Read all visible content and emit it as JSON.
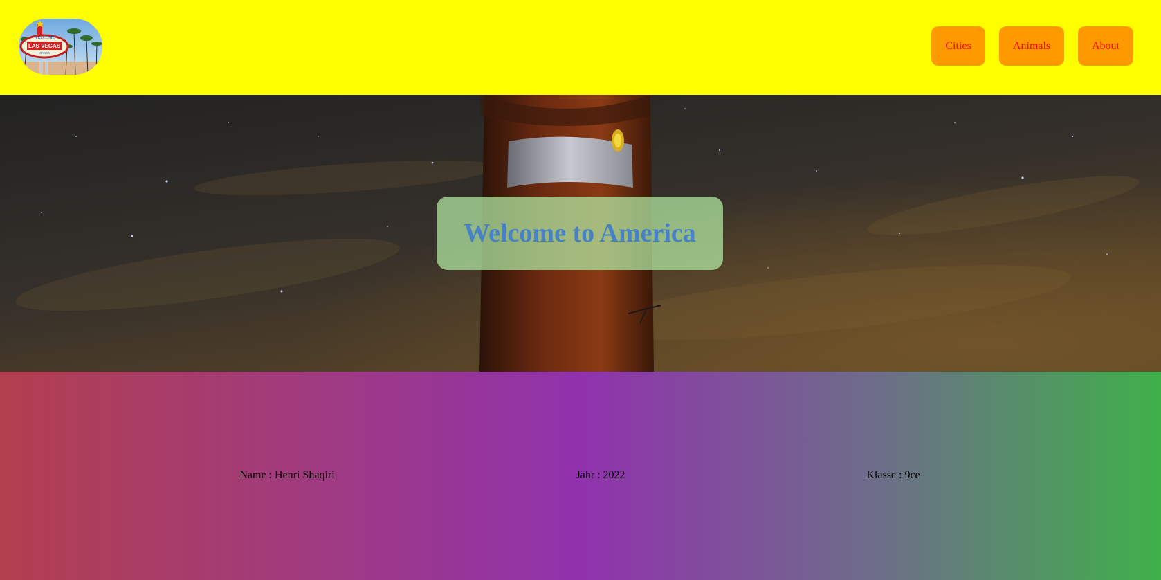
{
  "header": {
    "logo": {
      "icon": "las-vegas-sign-logo",
      "text": "LAS VEGAS"
    },
    "nav": [
      {
        "label": "Cities"
      },
      {
        "label": "Animals"
      },
      {
        "label": "About"
      }
    ]
  },
  "hero": {
    "title": "Welcome to America",
    "background": "lighthouse-night-sky-photo"
  },
  "footer": {
    "name": "Name : Henri Shaqiri",
    "year": "Jahr : 2022",
    "class": "Klasse : 9ce"
  },
  "colors": {
    "header_bg": "#ffff00",
    "nav_button_bg": "#ff9900",
    "nav_button_text": "#ff0000",
    "title_text": "#4682c4",
    "title_box": "#b0e6a0"
  }
}
